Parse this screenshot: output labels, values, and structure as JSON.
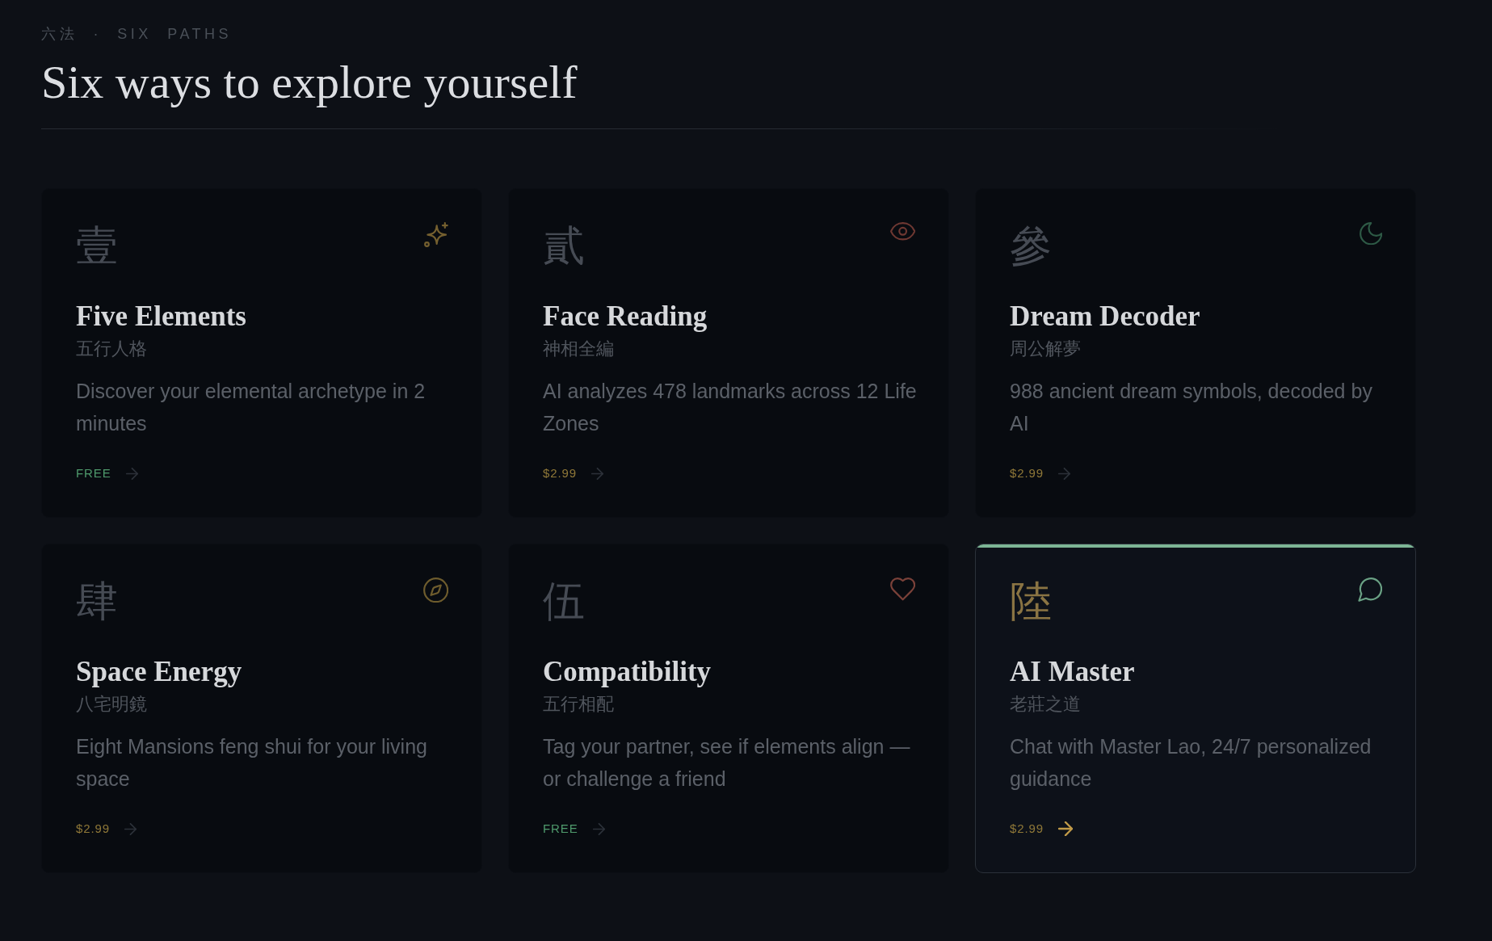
{
  "header": {
    "eyebrow": "六法 · SIX PATHS",
    "title": "Six ways to explore yourself"
  },
  "cards": [
    {
      "numeral": "壹",
      "title": "Five Elements",
      "subtitle": "五行人格",
      "description": "Discover your elemental archetype in 2 minutes",
      "price": {
        "text": "FREE",
        "color": "#4f9a6c"
      },
      "icon": {
        "kind": "sparkle",
        "color": "#75602f"
      },
      "selected": false
    },
    {
      "numeral": "貳",
      "title": "Face Reading",
      "subtitle": "神相全編",
      "description": "AI analyzes 478 landmarks across 12 Life Zones",
      "price": {
        "text": "$2.99",
        "color": "#8f7838"
      },
      "icon": {
        "kind": "eye",
        "color": "#6e3832"
      },
      "selected": false
    },
    {
      "numeral": "參",
      "title": "Dream Decoder",
      "subtitle": "周公解夢",
      "description": "988 ancient dream symbols, decoded by AI",
      "price": {
        "text": "$2.99",
        "color": "#8f7838"
      },
      "icon": {
        "kind": "moon",
        "color": "#2e5a46"
      },
      "selected": false
    },
    {
      "numeral": "肆",
      "title": "Space Energy",
      "subtitle": "八宅明鏡",
      "description": "Eight Mansions feng shui for your living space",
      "price": {
        "text": "$2.99",
        "color": "#8f7838"
      },
      "icon": {
        "kind": "compass",
        "color": "#6e5c2d"
      },
      "selected": false
    },
    {
      "numeral": "伍",
      "title": "Compatibility",
      "subtitle": "五行相配",
      "description": "Tag your partner, see if elements align — or challenge a friend",
      "price": {
        "text": "FREE",
        "color": "#4f9a6c"
      },
      "icon": {
        "kind": "heart",
        "color": "#7a4139"
      },
      "selected": false
    },
    {
      "numeral": "陸",
      "title": "AI Master",
      "subtitle": "老莊之道",
      "description": "Chat with Master Lao, 24/7 personalized guidance",
      "price": {
        "text": "$2.99",
        "color": "#8f7838"
      },
      "icon": {
        "kind": "chat",
        "color": "#6aa184"
      },
      "selected": true
    }
  ]
}
